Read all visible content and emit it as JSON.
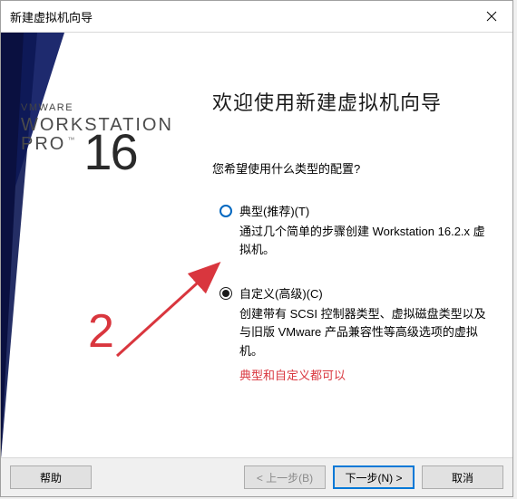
{
  "titlebar": {
    "title": "新建虚拟机向导"
  },
  "brand": {
    "vmware": "VMWARE",
    "workstation": "WORKSTATION",
    "pro": "PRO",
    "tm": "™",
    "version": "16"
  },
  "content": {
    "welcome": "欢迎使用新建虚拟机向导",
    "question": "您希望使用什么类型的配置?",
    "options": {
      "typical": {
        "label": "典型(推荐)(T)",
        "desc": "通过几个简单的步骤创建 Workstation 16.2.x 虚拟机。"
      },
      "custom": {
        "label": "自定义(高级)(C)",
        "desc": "创建带有 SCSI 控制器类型、虚拟磁盘类型以及与旧版 VMware 产品兼容性等高级选项的虚拟机。"
      }
    },
    "note": "典型和自定义都可以"
  },
  "annotation": {
    "number": "2"
  },
  "footer": {
    "help": "帮助",
    "back": "< 上一步(B)",
    "next": "下一步(N) >",
    "cancel": "取消"
  }
}
